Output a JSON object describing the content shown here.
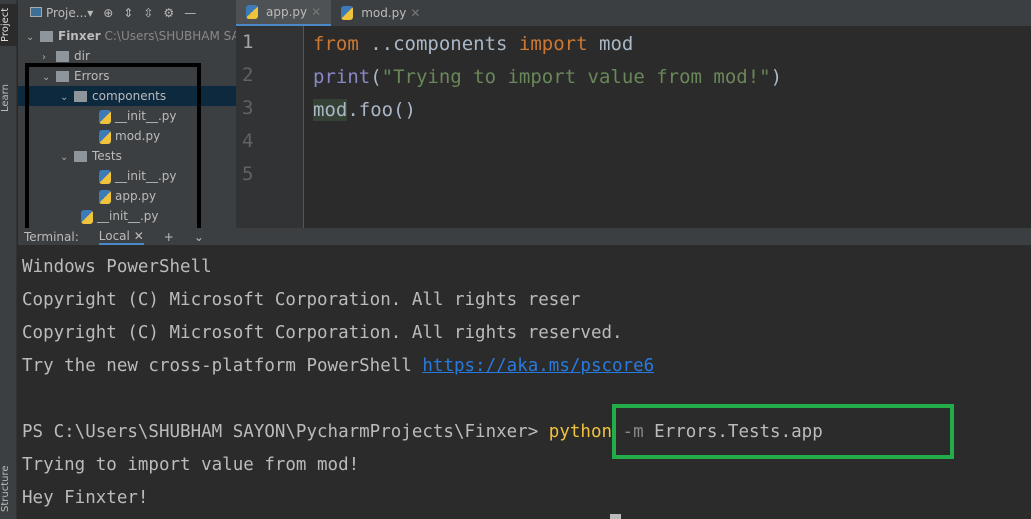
{
  "sidebar": {
    "project": "Project",
    "learn": "Learn",
    "structure": "Structure"
  },
  "project_panel": {
    "title": "Proje...",
    "root": "Finxer",
    "root_path": "C:\\Users\\SHUBHAM SAYON",
    "items": [
      {
        "label": "dir"
      },
      {
        "label": "Errors"
      },
      {
        "label": "components"
      },
      {
        "label": "__init__.py"
      },
      {
        "label": "mod.py"
      },
      {
        "label": "Tests"
      },
      {
        "label": "__init__.py"
      },
      {
        "label": "app.py"
      },
      {
        "label": "__init__.py"
      }
    ]
  },
  "editor": {
    "tabs": [
      {
        "label": "app.py"
      },
      {
        "label": "mod.py"
      }
    ],
    "line_numbers": [
      "1",
      "2",
      "3",
      "4",
      "5"
    ],
    "code": {
      "l1a": "from",
      "l1b": " ..components ",
      "l1c": "import",
      "l1d": " mod",
      "l2a": "print",
      "l2b": "(",
      "l2c": "\"Trying to import value from mod!\"",
      "l2d": ")",
      "l3a": "mod",
      ".l3b": "",
      "l3b": ".foo()"
    }
  },
  "terminal": {
    "title": "Terminal:",
    "tab": "Local",
    "lines": [
      "Windows PowerShell",
      "Copyright (C) Microsoft Corporation. All rights reser",
      "Copyright (C) Microsoft Corporation. All rights reserved."
    ],
    "try_text": "Try the new cross-platform PowerShell ",
    "link": "https://aka.ms/pscore6",
    "prompt": "PS C:\\Users\\SHUBHAM SAYON\\PycharmProjects\\Finxer> ",
    "cmd": "python",
    "flag": " -m",
    "args": " Errors.Tests.app",
    "output": [
      "Trying to import value from mod!",
      "Hey Finxter!"
    ]
  }
}
